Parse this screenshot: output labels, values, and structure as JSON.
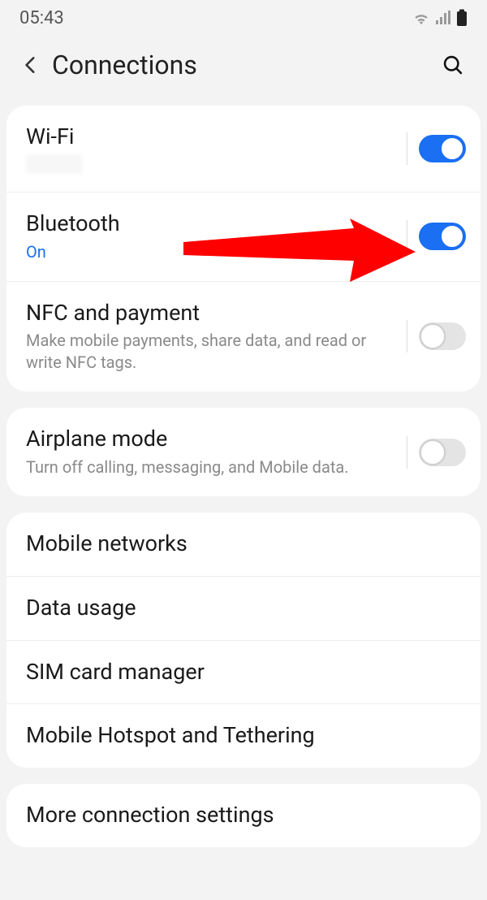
{
  "status": {
    "time": "05:43"
  },
  "header": {
    "title": "Connections"
  },
  "groups": [
    {
      "items": [
        {
          "title": "Wi-Fi",
          "sub": "",
          "sub_blank": true,
          "toggle": "on"
        },
        {
          "title": "Bluetooth",
          "sub": "On",
          "sub_accent": true,
          "toggle": "on",
          "annotated": true
        },
        {
          "title": "NFC and payment",
          "sub": "Make mobile payments, share data, and read or write NFC tags.",
          "toggle": "off"
        }
      ]
    },
    {
      "items": [
        {
          "title": "Airplane mode",
          "sub": "Turn off calling, messaging, and Mobile data.",
          "toggle": "off"
        }
      ]
    },
    {
      "items": [
        {
          "title": "Mobile networks"
        },
        {
          "title": "Data usage"
        },
        {
          "title": "SIM card manager"
        },
        {
          "title": "Mobile Hotspot and Tethering"
        }
      ]
    },
    {
      "items": [
        {
          "title": "More connection settings"
        }
      ]
    }
  ]
}
